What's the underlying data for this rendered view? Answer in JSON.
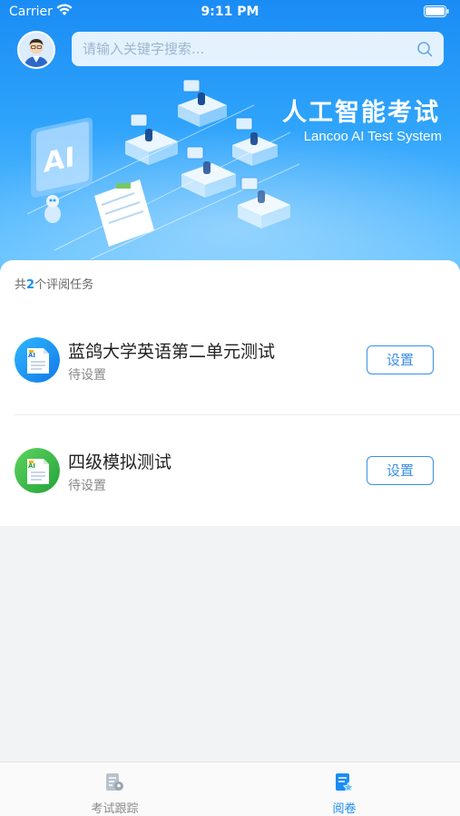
{
  "status_bar": {
    "carrier": "Carrier",
    "time": "9:11 PM"
  },
  "search": {
    "placeholder": "请输入关键字搜索..."
  },
  "hero": {
    "title": "人工智能考试",
    "subtitle": "Lancoo AI Test System",
    "illustration_text": "AI"
  },
  "task_summary": {
    "prefix": "共",
    "count": "2",
    "suffix": "个评阅任务"
  },
  "tasks": [
    {
      "title": "蓝鸽大学英语第二单元测试",
      "status": "待设置",
      "button": "设置",
      "icon_color": "#1aa1f7"
    },
    {
      "title": "四级模拟测试",
      "status": "待设置",
      "button": "设置",
      "icon_color": "#3ec24a"
    }
  ],
  "tabbar": {
    "tabs": [
      {
        "label": "考试跟踪",
        "icon": "exam-tracking-icon",
        "active": false
      },
      {
        "label": "阅卷",
        "icon": "grading-icon",
        "active": true
      }
    ]
  },
  "colors": {
    "accent": "#1a8cf5",
    "inactive": "#8a8a8a"
  }
}
